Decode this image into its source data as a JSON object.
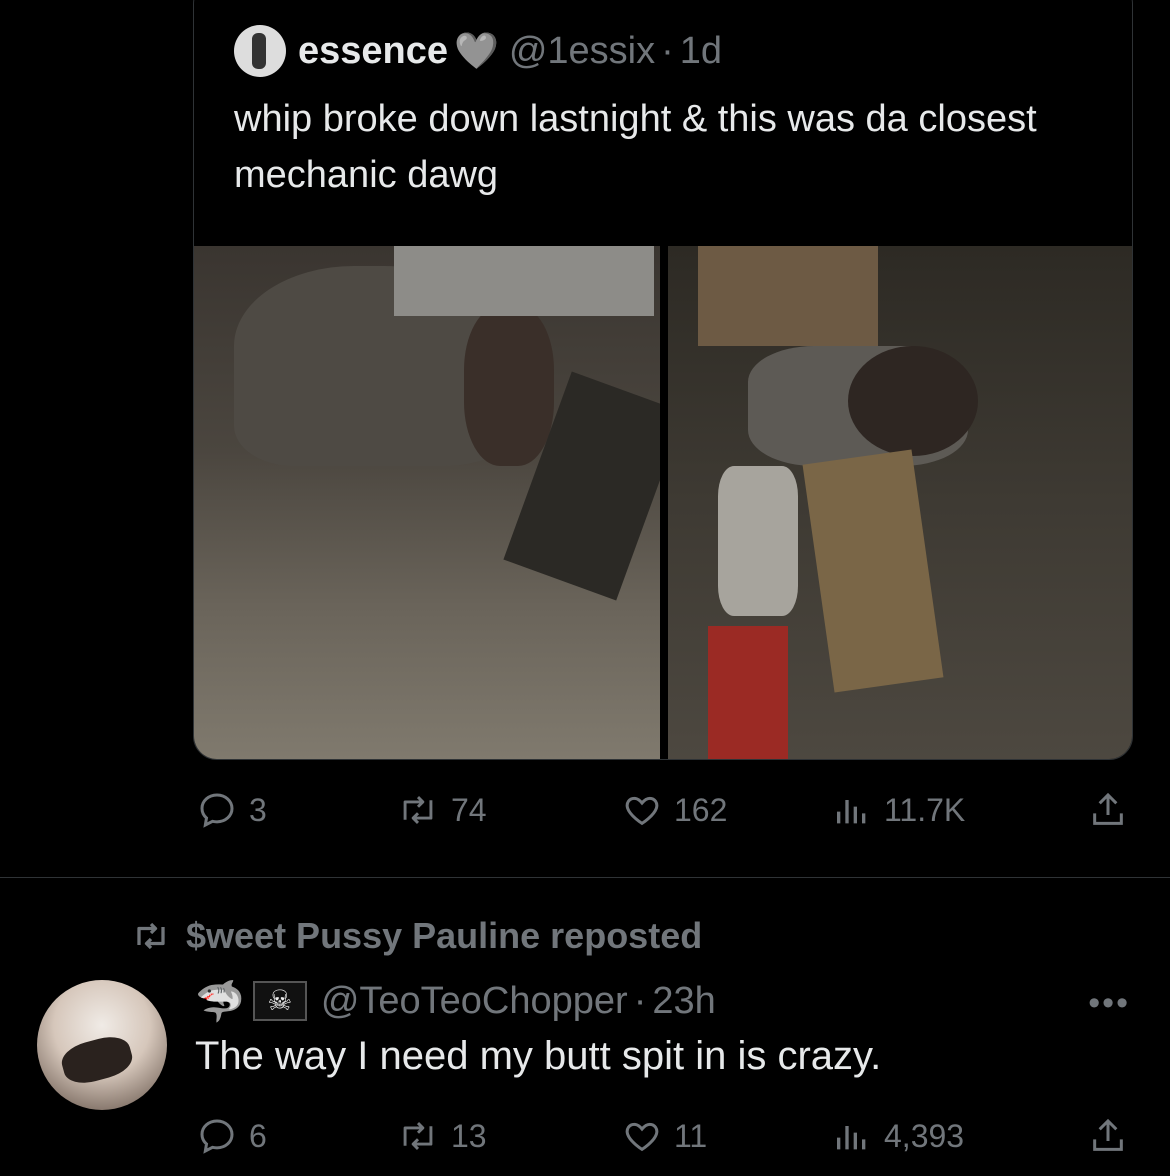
{
  "quoted_post": {
    "author_name": "essence",
    "name_emoji": "🩶",
    "handle": "@1essix",
    "separator": "·",
    "time": "1d",
    "text": "whip broke down lastnight & this was da closest mechanic dawg",
    "actions": {
      "replies": "3",
      "reposts": "74",
      "likes": "162",
      "views": "11.7K"
    }
  },
  "repost_header": {
    "label": "$weet Pussy Pauline reposted"
  },
  "post": {
    "name_emojis": [
      "🦈",
      "🏴‍☠️"
    ],
    "handle": "@TeoTeoChopper",
    "separator": "·",
    "time": "23h",
    "text": "The way I need my butt spit in is crazy.",
    "actions": {
      "replies": "6",
      "reposts": "13",
      "likes": "11",
      "views": "4,393"
    }
  },
  "colors": {
    "background": "#000000",
    "text": "#e7e9ea",
    "muted": "#71767b",
    "border": "#2f3336"
  },
  "icons": [
    "reply-icon",
    "repost-icon",
    "like-icon",
    "views-icon",
    "share-icon",
    "more-icon"
  ]
}
